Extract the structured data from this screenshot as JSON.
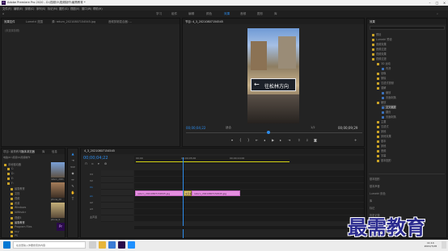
{
  "window": {
    "title": "Adobe Premiere Pro 2020 - D:\\视频\\5\\视频制作\\最需教育 *",
    "app_icon": "Pr"
  },
  "menu": [
    "文件(F)",
    "编辑(E)",
    "剪辑(C)",
    "序列(S)",
    "标记(M)",
    "图形(G)",
    "视图(V)",
    "窗口(W)",
    "帮助(H)"
  ],
  "workspaces": [
    "学习",
    "组件",
    "编辑",
    "颜色",
    "效果",
    "音频",
    "图形",
    "库"
  ],
  "active_workspace": "效果",
  "source_panel": {
    "tabs": [
      "效果控件",
      "Lumetri 范围",
      "源: return_20210807154545.jpg",
      "音频剪辑混合器: ..."
    ],
    "search_placeholder": "(未选择剪辑)"
  },
  "program_monitor": {
    "tab": "节目: 4_3_20210807154545",
    "timecode_left": "00;00;04;22",
    "fit": "适合",
    "zoom": "1/2",
    "timecode_right": "00;00;09;29",
    "video_sign_text": "往松林方向",
    "video_arrow": "←"
  },
  "effects_panel": {
    "tab": "效果",
    "items": [
      "预设",
      "Lumetri 预设",
      "音频效果",
      "音频过渡",
      "视频效果",
      "视频过渡",
      "3D 运动",
      "内滑",
      "划像",
      "擦除",
      "沉浸式视频",
      "溶解",
      "缩放",
      "页面剥落",
      "交叉缩放",
      "缩放",
      "翻页",
      "页面剥落",
      "主要",
      "沉浸式",
      "其他",
      "其他效果",
      "基本",
      "其他",
      "音频",
      "字幕",
      "基本图形"
    ],
    "sub_items": [
      "基本图形",
      "基本声音",
      "Lumetri 颜色",
      "库",
      "标记",
      "历史记录",
      "信息"
    ]
  },
  "project_panel": {
    "tabs": [
      "项目: 最需教育",
      "媒体浏览器",
      "库",
      "信息"
    ],
    "path": "电脑\\D:\\视频\\5\\视频制作",
    "tree": [
      "本地驱动器",
      "C:",
      "D:",
      "E:",
      "F:",
      "最需教育",
      "文档",
      "视频",
      "资源",
      "Windows",
      "IAWtsdcr",
      "视频5",
      "最需教育",
      "Program Files",
      "ncy",
      "PS",
      "Zhong"
    ],
    "thumbs": [
      "return_2021",
      "phone_20",
      "phone_9"
    ]
  },
  "timeline": {
    "tab": "4_3_20210807154545",
    "timecode": "00;00;04;22",
    "ruler": [
      "00;00",
      "00;00;05;00",
      "00;00;10;00"
    ],
    "tracks": [
      "V3",
      "V2",
      "V1",
      "A1",
      "A2",
      "A3"
    ],
    "master": "主声道",
    "clip1_label": "return_20210807154545.jpg",
    "clip2_label": "return_20210807154545.jpg",
    "transition_label": "交叉缩放"
  },
  "watermark": "最需教育",
  "taskbar": {
    "search_hint": "在这里输入你要搜索的内容",
    "time": "11:14",
    "date": "2021/7/28"
  },
  "colors": {
    "accent": "#2d8ceb",
    "clip": "#e58fe0",
    "clip_dark": "#c266c0",
    "playhead": "#2d8ceb"
  }
}
